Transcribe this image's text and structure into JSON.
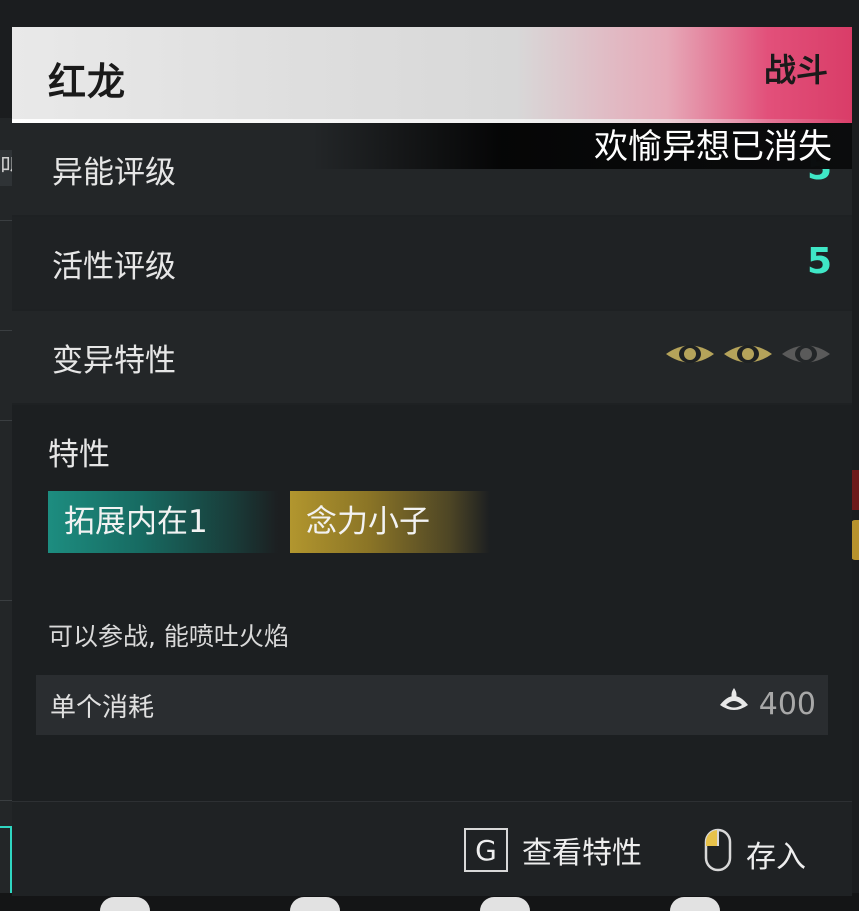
{
  "title": "红龙",
  "badge": "战斗",
  "status_message": "欢愉异想已消失",
  "stats": [
    {
      "label": "异能评级",
      "value": "5"
    },
    {
      "label": "活性评级",
      "value": "5"
    }
  ],
  "mutation": {
    "label": "变异特性",
    "filled": 2,
    "total": 3
  },
  "traits": {
    "label": "特性",
    "chips": [
      "拓展内在1",
      "念力小子"
    ]
  },
  "description": "可以参战, 能喷吐火焰",
  "cost": {
    "label": "单个消耗",
    "value": "400",
    "icon": "currency-icon"
  },
  "actions": {
    "view": {
      "key": "G",
      "label": "查看特性"
    },
    "store": {
      "icon": "mouse-left-icon",
      "label": "存入"
    }
  },
  "background": {
    "left_char": "叫"
  },
  "colors": {
    "accent_teal": "#3fe7c6",
    "accent_pink": "#e2507a",
    "eye_active": "#b5a35a",
    "eye_inactive": "#5a5a5a"
  }
}
